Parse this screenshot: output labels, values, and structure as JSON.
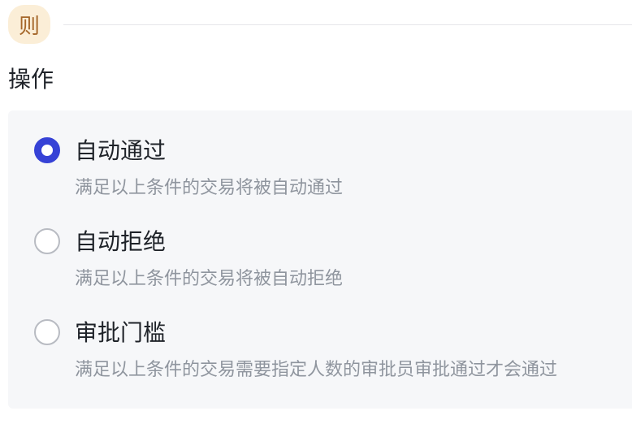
{
  "badge": {
    "label": "则"
  },
  "section": {
    "label": "操作"
  },
  "options": [
    {
      "title": "自动通过",
      "description": "满足以上条件的交易将被自动通过",
      "selected": true
    },
    {
      "title": "自动拒绝",
      "description": "满足以上条件的交易将被自动拒绝",
      "selected": false
    },
    {
      "title": "审批门槛",
      "description": "满足以上条件的交易需要指定人数的审批员审批通过才会通过",
      "selected": false
    }
  ],
  "colors": {
    "accent": "#3642d6",
    "badge_bg": "#fbeed7",
    "badge_text": "#a5672a",
    "panel_bg": "#f6f7f9",
    "muted_text": "#8f959e"
  }
}
